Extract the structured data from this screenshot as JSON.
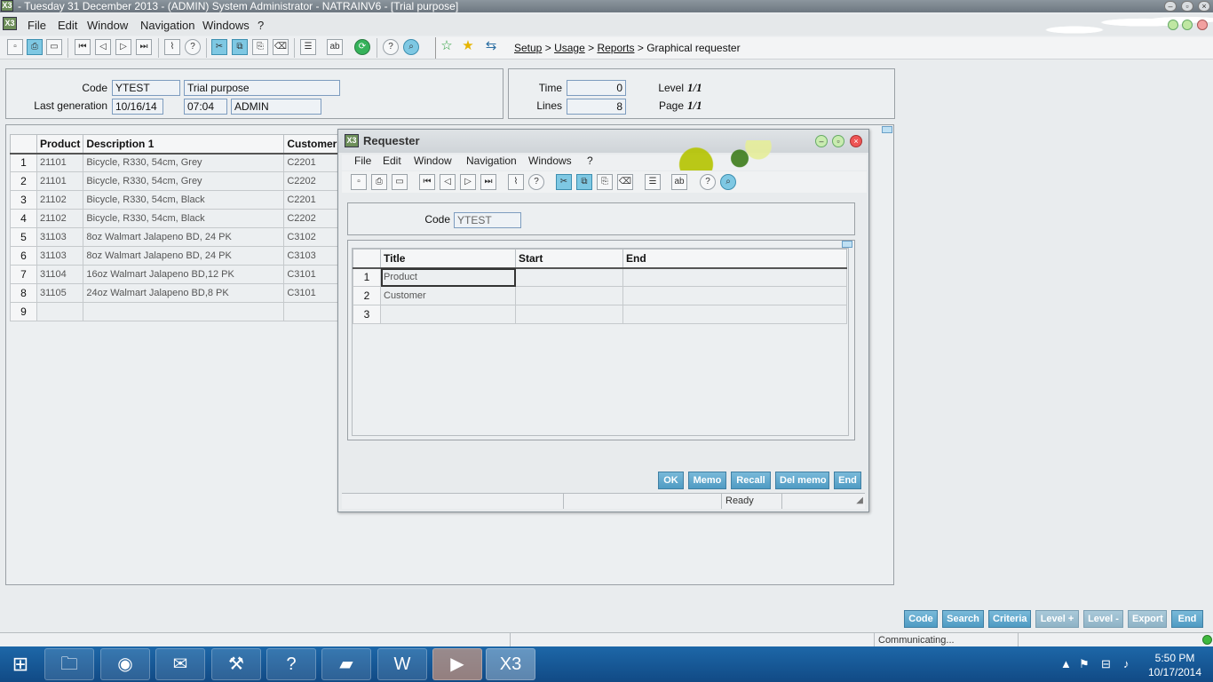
{
  "window": {
    "title": "- Tuesday 31 December 2013 - (ADMIN) System Administrator - NATRAINV6 - [Trial purpose]",
    "app_icon": "X3"
  },
  "menu": [
    "File",
    "Edit",
    "Window",
    "Navigation",
    "Windows",
    "?"
  ],
  "breadcrumb": {
    "items": [
      "Setup",
      "Usage",
      "Reports"
    ],
    "current": "Graphical requester",
    "sep": ">"
  },
  "header": {
    "code_label": "Code",
    "code_value": "YTEST",
    "description": "Trial purpose",
    "last_gen_label": "Last generation",
    "last_gen_date": "10/16/14",
    "last_gen_time": "07:04",
    "last_gen_user": "ADMIN",
    "time_label": "Time",
    "time_value": "0",
    "lines_label": "Lines",
    "lines_value": "8",
    "level_label": "Level",
    "level_value": "1/1",
    "page_label": "Page",
    "page_value": "1/1"
  },
  "main_grid": {
    "columns": [
      "Product",
      "Description 1",
      "Customer"
    ],
    "rows": [
      {
        "n": "1",
        "product": "21101",
        "desc": "Bicycle, R330, 54cm, Grey",
        "customer": "C2201"
      },
      {
        "n": "2",
        "product": "21101",
        "desc": "Bicycle, R330, 54cm, Grey",
        "customer": "C2202"
      },
      {
        "n": "3",
        "product": "21102",
        "desc": "Bicycle, R330, 54cm, Black",
        "customer": "C2201"
      },
      {
        "n": "4",
        "product": "21102",
        "desc": "Bicycle, R330, 54cm, Black",
        "customer": "C2202"
      },
      {
        "n": "5",
        "product": "31103",
        "desc": "8oz Walmart Jalapeno BD, 24 PK",
        "customer": "C3102"
      },
      {
        "n": "6",
        "product": "31103",
        "desc": "8oz Walmart Jalapeno BD, 24 PK",
        "customer": "C3103"
      },
      {
        "n": "7",
        "product": "31104",
        "desc": "16oz Walmart Jalapeno BD,12 PK",
        "customer": "C3101"
      },
      {
        "n": "8",
        "product": "31105",
        "desc": "24oz Walmart Jalapeno BD,8 PK",
        "customer": "C3101"
      },
      {
        "n": "9",
        "product": "",
        "desc": "",
        "customer": ""
      }
    ]
  },
  "requester": {
    "title": "Requester",
    "menu": [
      "File",
      "Edit",
      "Window",
      "Navigation",
      "Windows",
      "?"
    ],
    "code_label": "Code",
    "code_value": "YTEST",
    "columns": [
      "Title",
      "Start",
      "End"
    ],
    "rows": [
      {
        "n": "1",
        "title": "Product",
        "start": "",
        "end": ""
      },
      {
        "n": "2",
        "title": "Customer",
        "start": "",
        "end": ""
      },
      {
        "n": "3",
        "title": "",
        "start": "",
        "end": ""
      }
    ],
    "buttons": [
      "OK",
      "Memo",
      "Recall",
      "Del memo",
      "End"
    ],
    "status": "Ready"
  },
  "bottom_buttons": [
    "Code",
    "Search",
    "Criteria",
    "Level +",
    "Level -",
    "Export",
    "End"
  ],
  "status": {
    "text": "Communicating..."
  },
  "taskbar": {
    "time": "5:50 PM",
    "date": "10/17/2014"
  },
  "colors": {
    "button": "#4f9bc3",
    "titlebar": "#6d7780",
    "taskbar": "#114a85"
  }
}
